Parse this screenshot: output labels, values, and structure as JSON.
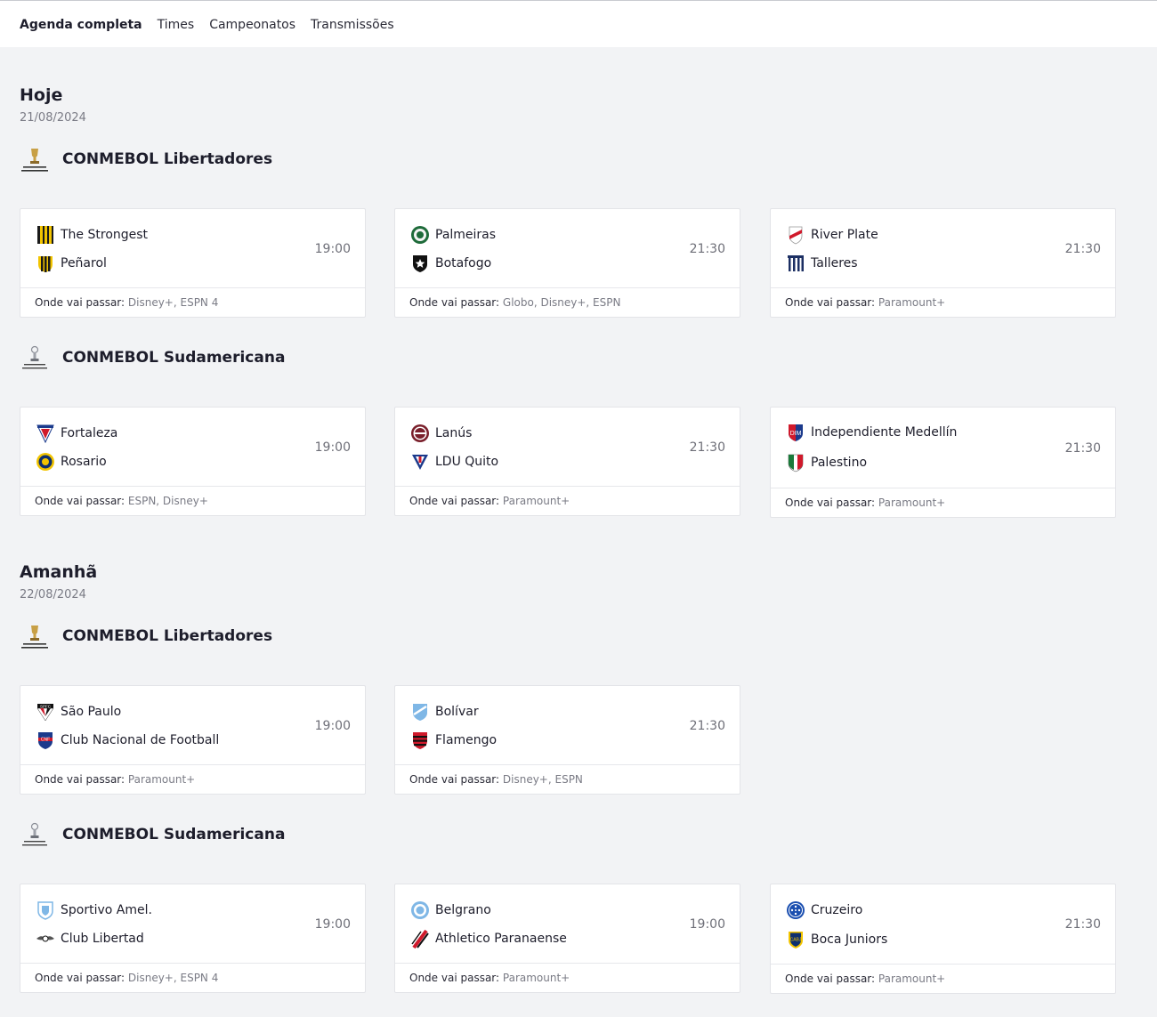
{
  "nav": {
    "tabs": [
      {
        "label": "Agenda completa",
        "active": true
      },
      {
        "label": "Times"
      },
      {
        "label": "Campeonatos"
      },
      {
        "label": "Transmissões"
      }
    ]
  },
  "colors": {
    "background": "#f2f3f5",
    "card": "#ffffff",
    "text": "#1d1d2b",
    "muted": "#7a7b85"
  },
  "days": [
    {
      "title": "Hoje",
      "date": "21/08/2024",
      "competitions": [
        {
          "name": "CONMEBOL Libertadores",
          "logo": "libertadores-trophy-icon",
          "matches": [
            {
              "home": "The Strongest",
              "away": "Peñarol",
              "time": "19:00",
              "label": "Onde vai passar:",
              "channels": "Disney+, ESPN 4"
            },
            {
              "home": "Palmeiras",
              "away": "Botafogo",
              "time": "21:30",
              "label": "Onde vai passar:",
              "channels": "Globo, Disney+, ESPN"
            },
            {
              "home": "River Plate",
              "away": "Talleres",
              "time": "21:30",
              "label": "Onde vai passar:",
              "channels": "Paramount+"
            }
          ]
        },
        {
          "name": "CONMEBOL Sudamericana",
          "logo": "sudamericana-trophy-icon",
          "matches": [
            {
              "home": "Fortaleza",
              "away": "Rosario",
              "time": "19:00",
              "label": "Onde vai passar:",
              "channels": "ESPN, Disney+"
            },
            {
              "home": "Lanús",
              "away": "LDU Quito",
              "time": "21:30",
              "label": "Onde vai passar:",
              "channels": "Paramount+"
            },
            {
              "home": "Independiente Medellín",
              "away": "Palestino",
              "time": "21:30",
              "label": "Onde vai passar:",
              "channels": "Paramount+"
            }
          ]
        }
      ]
    },
    {
      "title": "Amanhã",
      "date": "22/08/2024",
      "competitions": [
        {
          "name": "CONMEBOL Libertadores",
          "logo": "libertadores-trophy-icon",
          "matches": [
            {
              "home": "São Paulo",
              "away": "Club Nacional de Football",
              "time": "19:00",
              "label": "Onde vai passar:",
              "channels": "Paramount+"
            },
            {
              "home": "Bolívar",
              "away": "Flamengo",
              "time": "21:30",
              "label": "Onde vai passar:",
              "channels": "Disney+, ESPN"
            }
          ]
        },
        {
          "name": "CONMEBOL Sudamericana",
          "logo": "sudamericana-trophy-icon",
          "matches": [
            {
              "home": "Sportivo Amel.",
              "away": "Club Libertad",
              "time": "19:00",
              "label": "Onde vai passar:",
              "channels": "Disney+, ESPN 4"
            },
            {
              "home": "Belgrano",
              "away": "Athletico Paranaense",
              "time": "19:00",
              "label": "Onde vai passar:",
              "channels": "Paramount+"
            },
            {
              "home": "Cruzeiro",
              "away": "Boca Juniors",
              "time": "21:30",
              "label": "Onde vai passar:",
              "channels": "Paramount+"
            }
          ]
        }
      ]
    }
  ]
}
